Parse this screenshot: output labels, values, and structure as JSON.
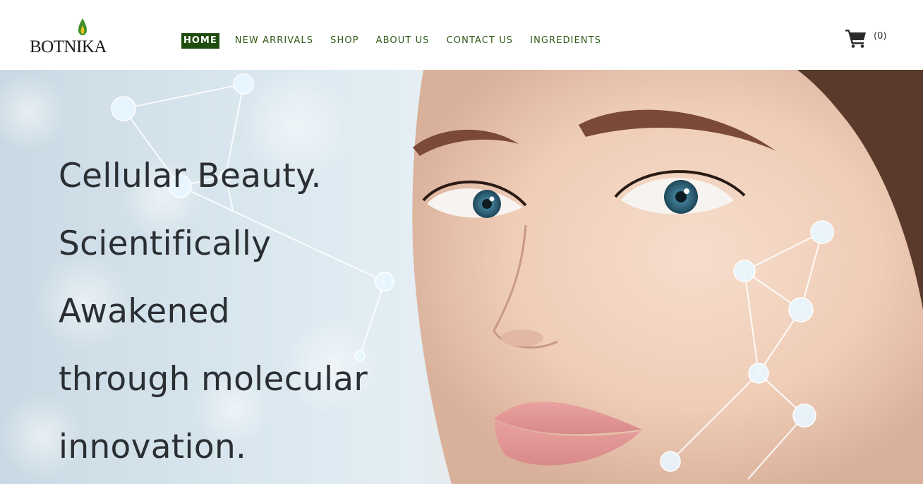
{
  "brand": {
    "name": "BOTNIKA",
    "logo_icon": "green-flame-drop-icon",
    "colors": {
      "drop_green": "#3f8f2a",
      "drop_yellow": "#e9c21c",
      "text": "#1a1a1a"
    }
  },
  "nav": {
    "items": [
      {
        "label": "HOME",
        "active": true
      },
      {
        "label": "NEW ARRIVALS",
        "active": false
      },
      {
        "label": "SHOP",
        "active": false
      },
      {
        "label": "ABOUT US",
        "active": false
      },
      {
        "label": "CONTACT US",
        "active": false
      },
      {
        "label": "INGREDIENTS",
        "active": false
      }
    ],
    "colors": {
      "text": "#2f5a15",
      "active_bg": "#1f4d0f",
      "active_text": "#ffffff"
    }
  },
  "cart": {
    "icon": "shopping-cart-icon",
    "count_label": "(0)"
  },
  "hero": {
    "headline_lines": [
      "Cellular Beauty.",
      "Scientifically",
      "Awakened",
      "through molecular",
      "innovation."
    ],
    "image": "woman-face-with-molecular-network-photo"
  }
}
